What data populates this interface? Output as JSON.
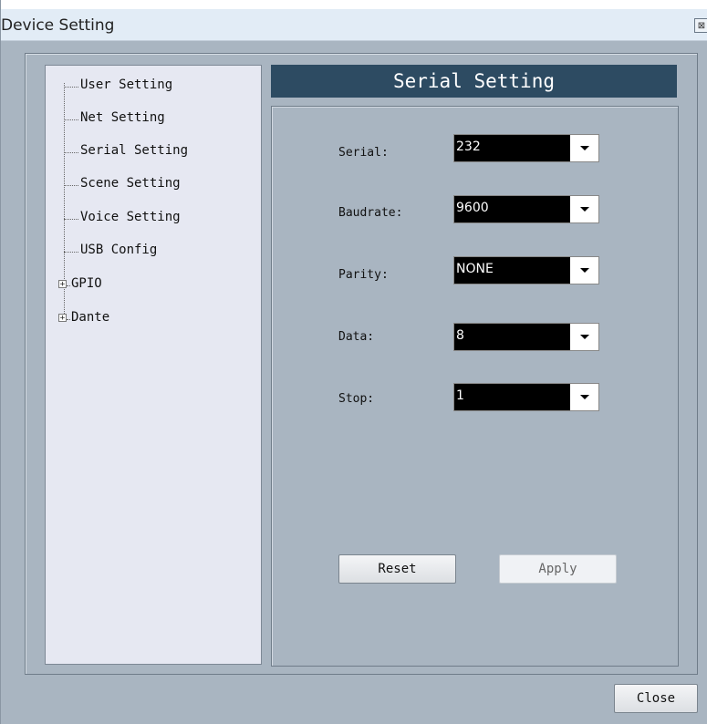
{
  "window": {
    "title": "Device Setting",
    "close_glyph": "⊠"
  },
  "tree": {
    "items": [
      {
        "label": "User Setting",
        "expandable": false
      },
      {
        "label": "Net Setting",
        "expandable": false
      },
      {
        "label": "Serial Setting",
        "expandable": false
      },
      {
        "label": "Scene Setting",
        "expandable": false
      },
      {
        "label": "Voice Setting",
        "expandable": false
      },
      {
        "label": "USB Config",
        "expandable": false
      },
      {
        "label": "GPIO",
        "expandable": true
      },
      {
        "label": "Dante",
        "expandable": true
      }
    ],
    "expand_glyph": "+"
  },
  "panel": {
    "header": "Serial Setting",
    "fields": [
      {
        "label": "Serial:",
        "value": "232"
      },
      {
        "label": "Baudrate:",
        "value": "9600"
      },
      {
        "label": "Parity:",
        "value": "NONE"
      },
      {
        "label": "Data:",
        "value": "8"
      },
      {
        "label": "Stop:",
        "value": "1"
      }
    ],
    "reset_label": "Reset",
    "apply_label": "Apply"
  },
  "footer": {
    "close_label": "Close"
  },
  "colors": {
    "window_bg": "#a9b5c1",
    "header_bg": "#2d4b62",
    "tree_bg": "#e6e8f2",
    "combo_bg": "#000000"
  }
}
